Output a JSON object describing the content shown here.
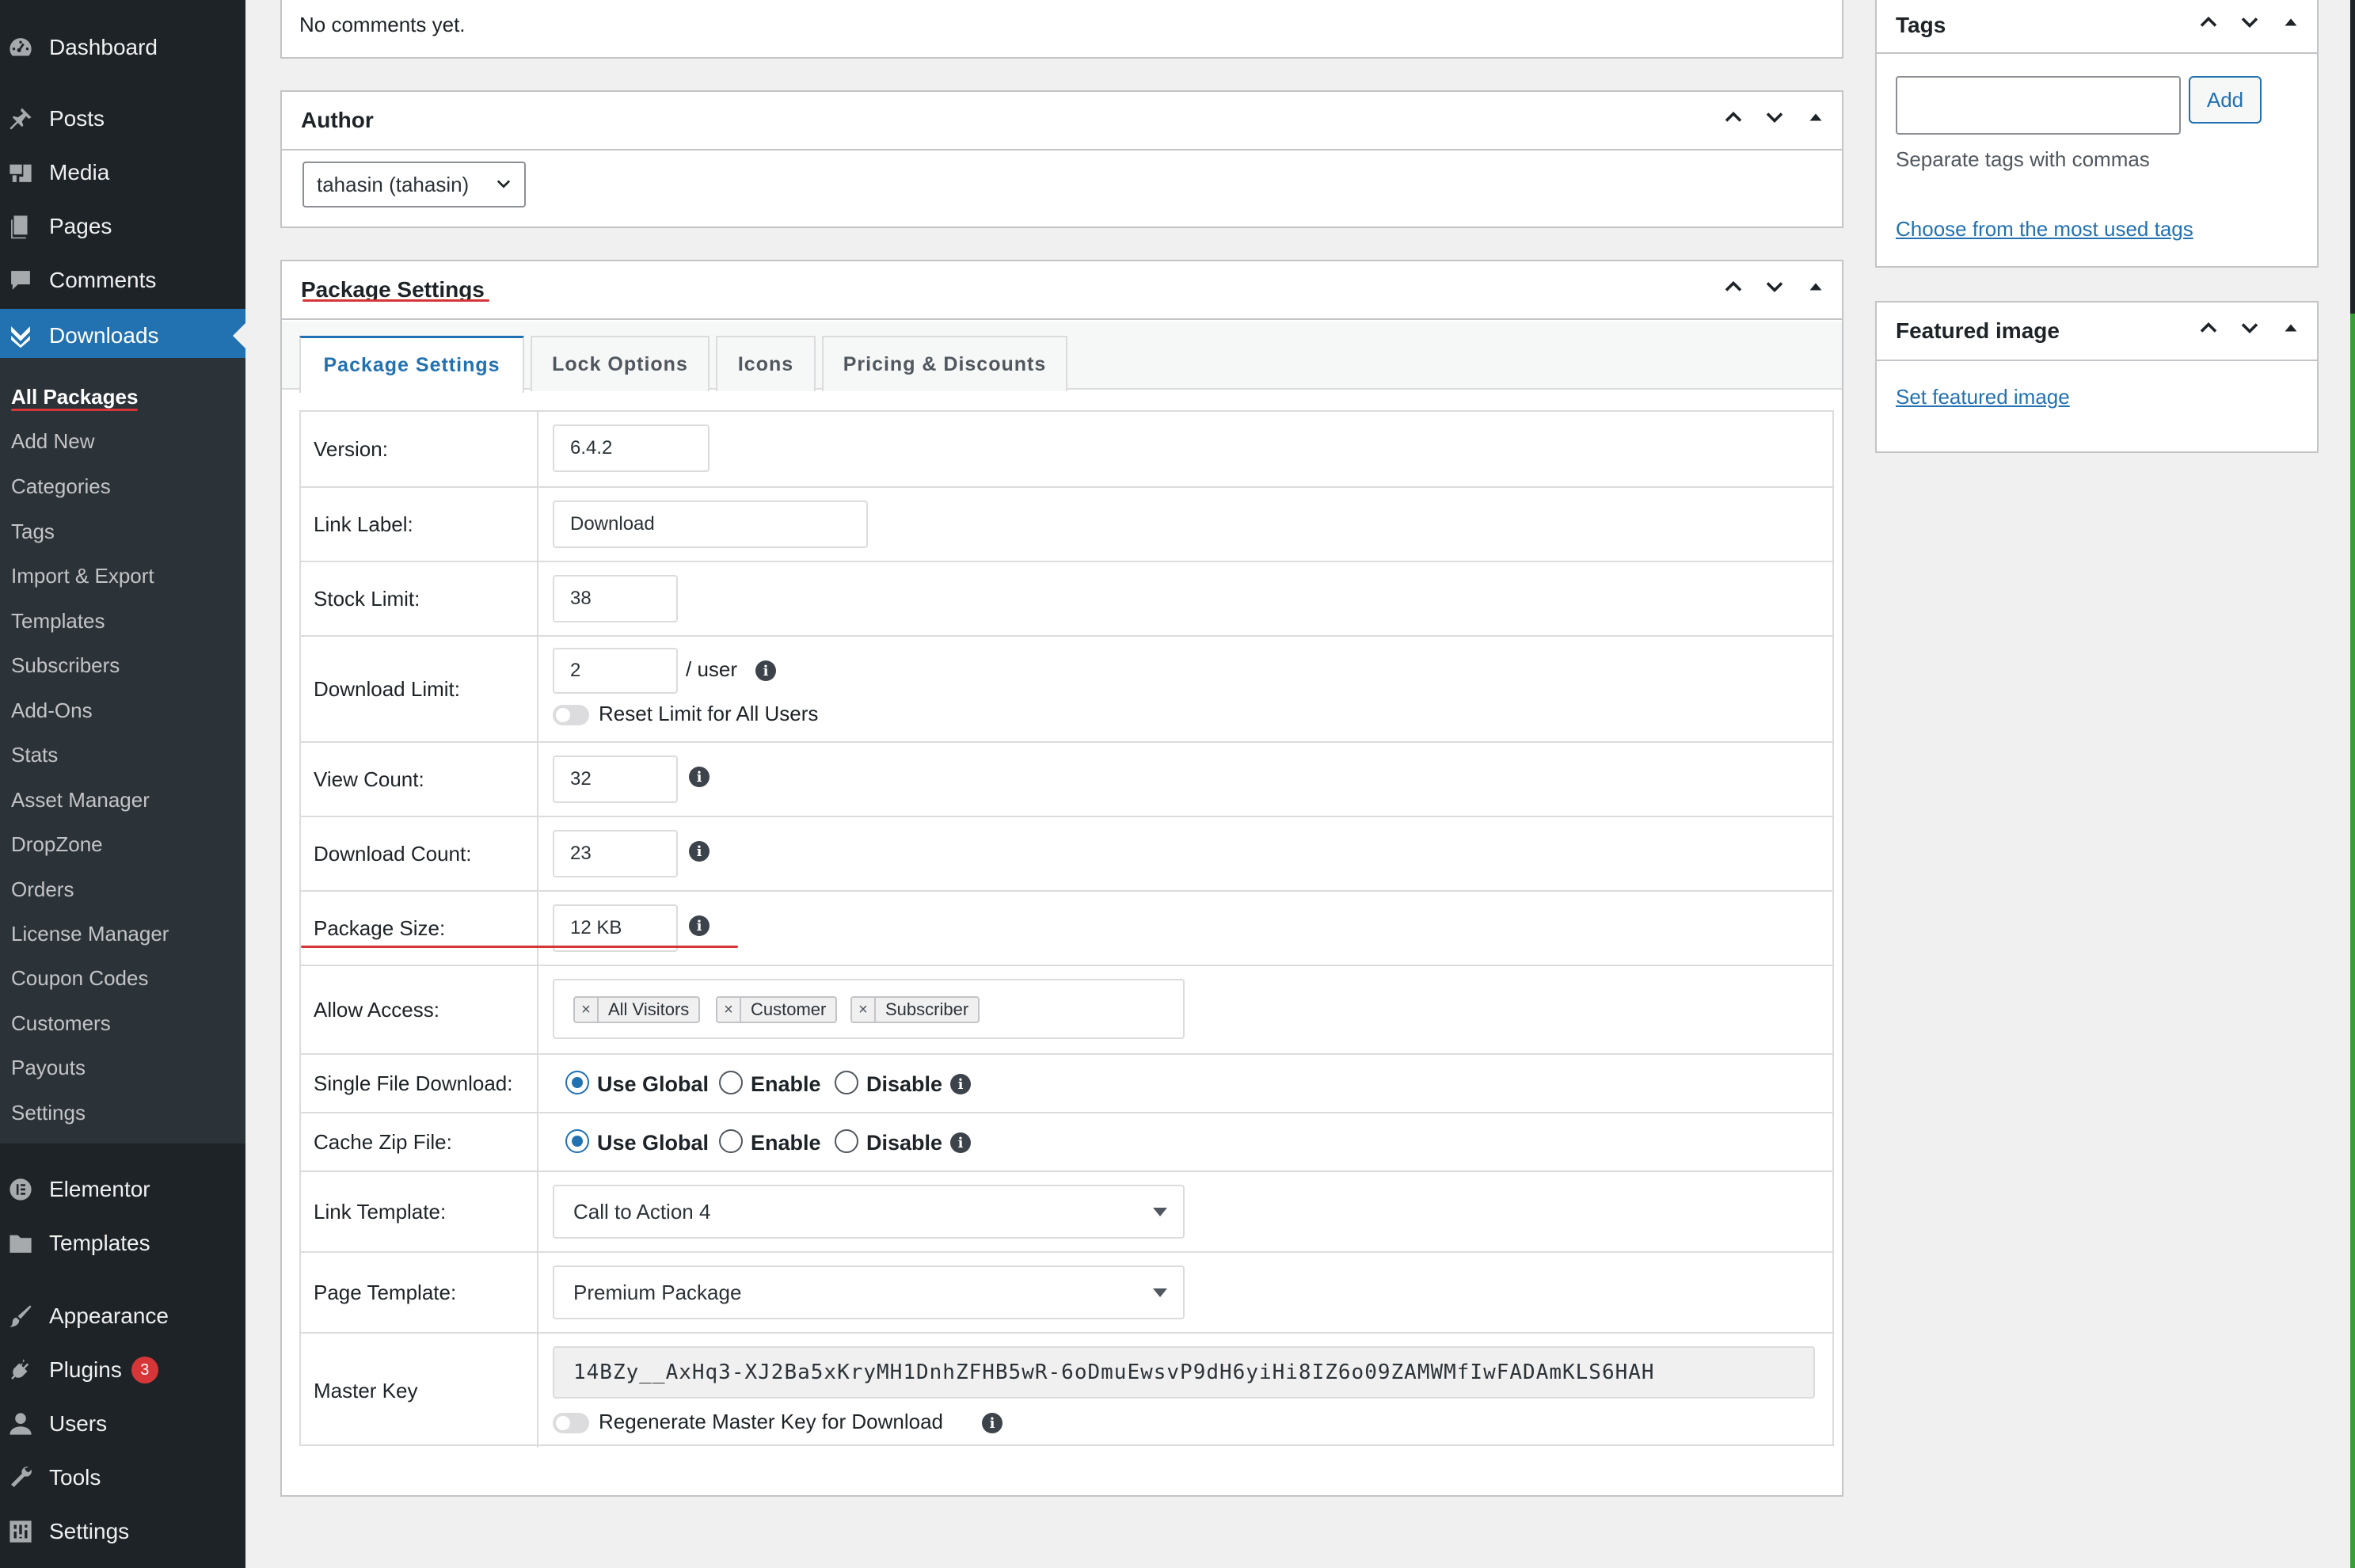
{
  "sidebar": {
    "dashboard": "Dashboard",
    "posts": "Posts",
    "media": "Media",
    "pages": "Pages",
    "comments": "Comments",
    "downloads": "Downloads",
    "sub": [
      "All Packages",
      "Add New",
      "Categories",
      "Tags",
      "Import & Export",
      "Templates",
      "Subscribers",
      "Add-Ons",
      "Stats",
      "Asset Manager",
      "DropZone",
      "Orders",
      "License Manager",
      "Coupon Codes",
      "Customers",
      "Payouts",
      "Settings"
    ],
    "elementor": "Elementor",
    "templates": "Templates",
    "appearance": "Appearance",
    "plugins": "Plugins",
    "plugins_badge": "3",
    "users": "Users",
    "tools": "Tools",
    "settings": "Settings"
  },
  "comments_box": {
    "text": "No comments yet."
  },
  "author_box": {
    "title": "Author",
    "selected": "tahasin (tahasin)"
  },
  "package_box": {
    "title": "Package Settings",
    "tabs": [
      "Package Settings",
      "Lock Options",
      "Icons",
      "Pricing & Discounts"
    ],
    "version_label": "Version:",
    "version": "6.4.2",
    "link_label_label": "Link Label:",
    "link_label": "Download",
    "stock_label": "Stock Limit:",
    "stock": "38",
    "dl_limit_label": "Download Limit:",
    "dl_limit": "2",
    "per_user": "/ user",
    "reset_limit": "Reset Limit for All Users",
    "view_count_label": "View Count:",
    "view_count": "32",
    "dl_count_label": "Download Count:",
    "dl_count": "23",
    "size_label": "Package Size:",
    "size": "12 KB",
    "access_label": "Allow Access:",
    "access": [
      "All Visitors",
      "Customer",
      "Subscriber"
    ],
    "single_label": "Single File Download:",
    "cache_label": "Cache Zip File:",
    "radio_global": "Use Global",
    "radio_enable": "Enable",
    "radio_disable": "Disable",
    "link_tpl_label": "Link Template:",
    "link_tpl": "Call to Action 4",
    "page_tpl_label": "Page Template:",
    "page_tpl": "Premium Package",
    "master_label": "Master Key",
    "master_key": "14BZy__AxHq3-XJ2Ba5xKryMH1DnhZFHB5wR-6oDmuEwsvP9dH6yiHi8IZ6o09ZAMWMfIwFADAmKLS6HAH",
    "regen": "Regenerate Master Key for Download"
  },
  "tags_box": {
    "title": "Tags",
    "add": "Add",
    "hint": "Separate tags with commas",
    "choose": "Choose from the most used tags"
  },
  "featured_box": {
    "title": "Featured image",
    "set": "Set featured image"
  },
  "colors": {
    "accent": "#2271b1",
    "sidebar": "#1d2327",
    "submenu": "#2c3338",
    "badge": "#d63638"
  }
}
